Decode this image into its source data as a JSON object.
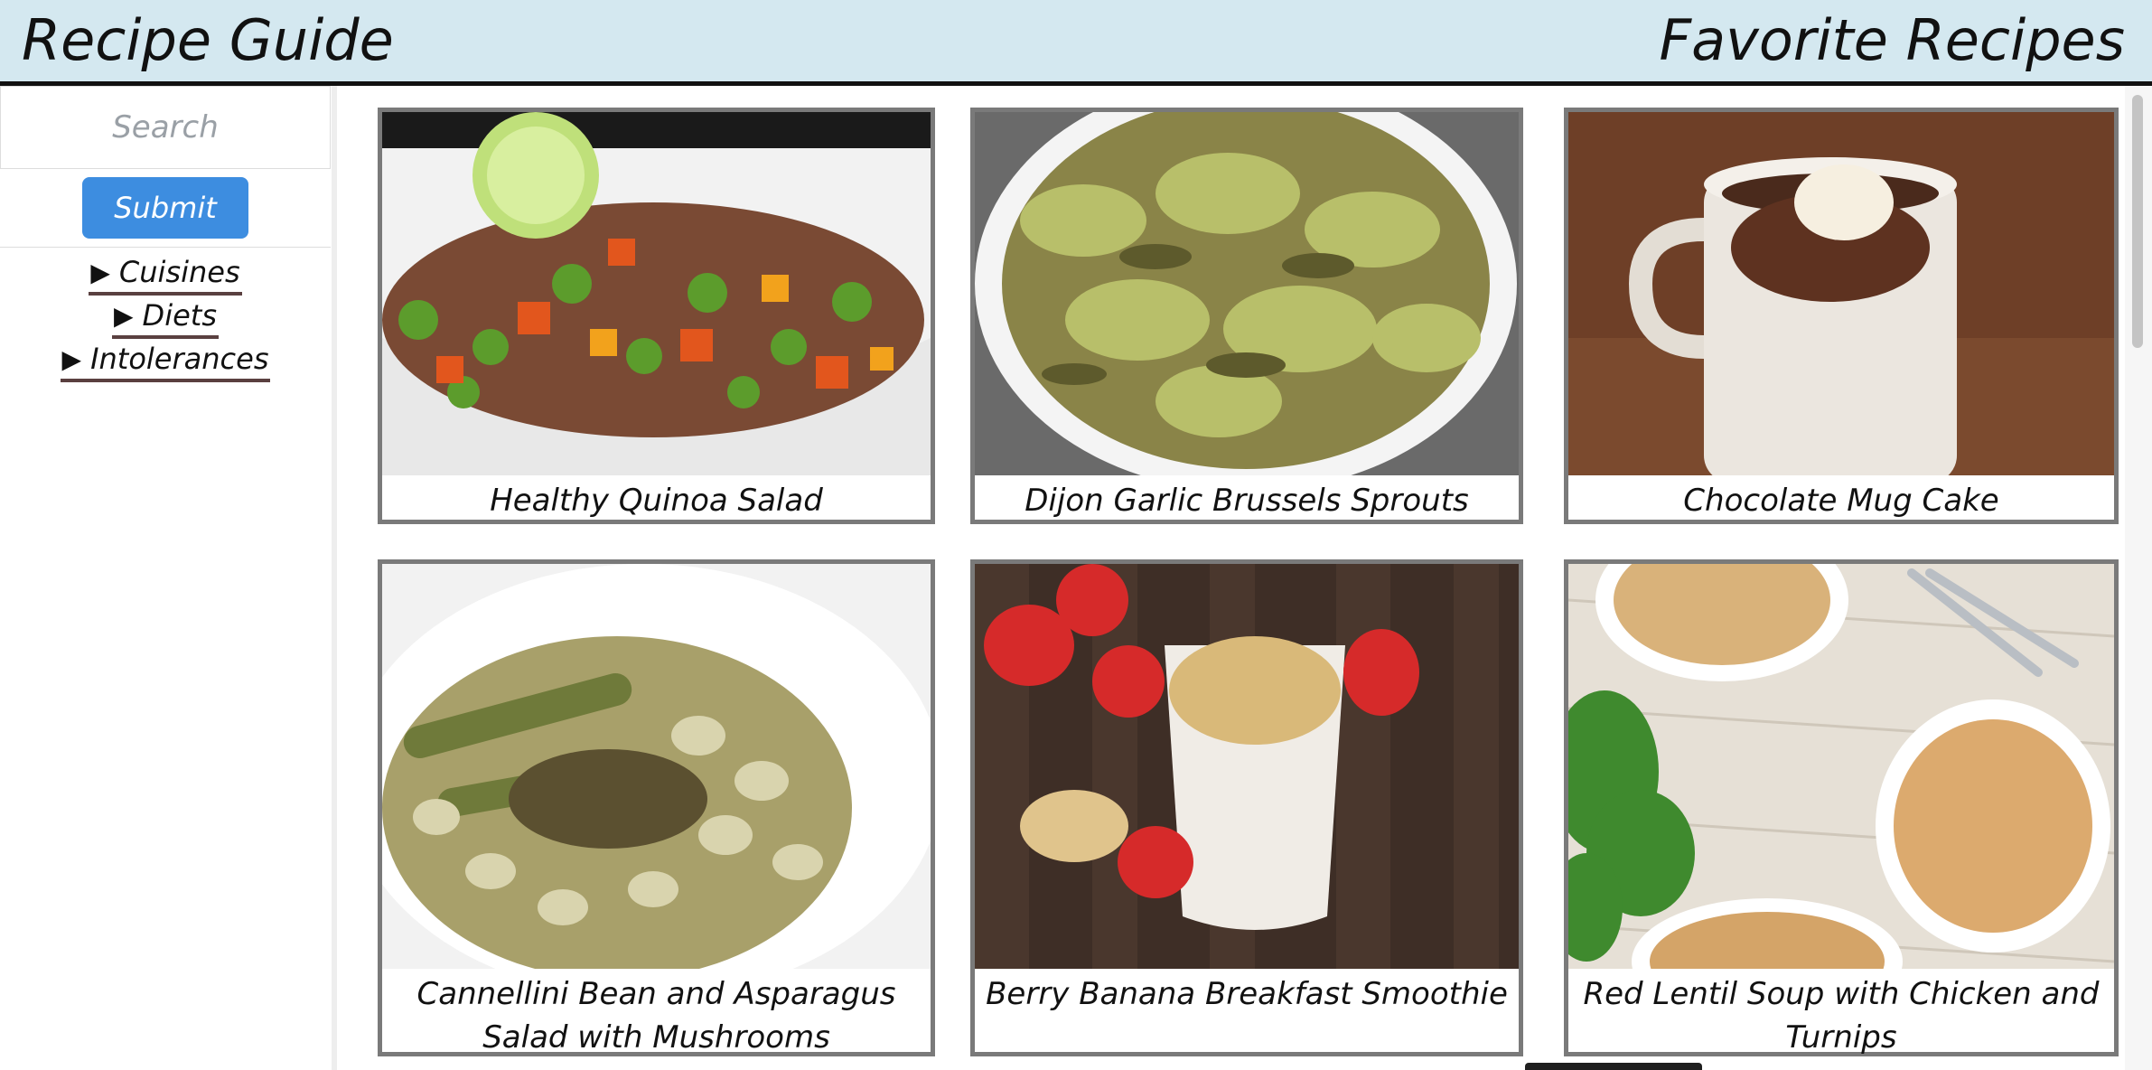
{
  "header": {
    "app_title": "Recipe Guide",
    "section_title": "Favorite Recipes"
  },
  "sidebar": {
    "search_placeholder": "Search",
    "submit_label": "Submit",
    "filters": [
      {
        "label": "Cuisines",
        "icon": "triangle-right-icon"
      },
      {
        "label": "Diets",
        "icon": "triangle-right-icon"
      },
      {
        "label": "Intolerances",
        "icon": "triangle-right-icon"
      }
    ]
  },
  "recipes": [
    {
      "title": "Healthy Quinoa Salad",
      "image": "quinoa-salad-photo"
    },
    {
      "title": "Dijon Garlic Brussels Sprouts",
      "image": "brussels-sprouts-photo"
    },
    {
      "title": "Chocolate Mug Cake",
      "image": "mug-cake-photo"
    },
    {
      "title": "Cannellini Bean and Asparagus Salad with Mushrooms",
      "image": "bean-asparagus-photo"
    },
    {
      "title": "Berry Banana Breakfast Smoothie",
      "image": "smoothie-photo"
    },
    {
      "title": "Red Lentil Soup with Chicken and Turnips",
      "image": "lentil-soup-photo"
    }
  ],
  "colors": {
    "header_bg": "#d4e8f0",
    "submit_bg": "#3d8de0",
    "card_border": "#7a7a7a"
  }
}
